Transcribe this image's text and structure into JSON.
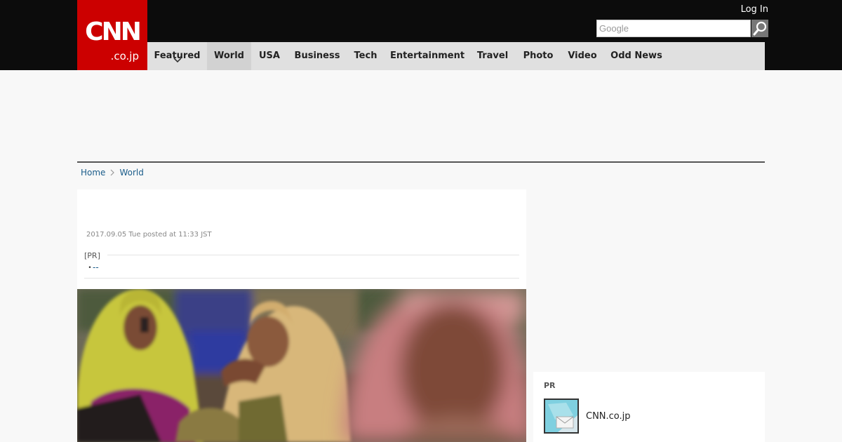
{
  "header": {
    "logo_main": "CNN",
    "logo_sub": ".co.jp",
    "login_label": "Log In",
    "search": {
      "placeholder": "Google",
      "button_icon": "magnifier-icon"
    }
  },
  "nav": {
    "items": [
      {
        "label": "Featured"
      },
      {
        "label": "World"
      },
      {
        "label": "USA"
      },
      {
        "label": "Business"
      },
      {
        "label": "Tech"
      },
      {
        "label": "Entertainment"
      },
      {
        "label": "Travel"
      },
      {
        "label": "Photo"
      },
      {
        "label": "Video"
      },
      {
        "label": "Odd News"
      }
    ],
    "active": "World",
    "featured_icon": "chevron-down-icon"
  },
  "breadcrumb": {
    "home": "Home",
    "current": "World",
    "separator_icon": "chevron-right-icon"
  },
  "article": {
    "posted": "2017.09.05 Tue posted at 11:33 JST",
    "pr_label": "[PR]",
    "pr_bullet": "・",
    "pr_link": "--"
  },
  "sidebar": {
    "pr_title": "PR",
    "pr_item_label": "CNN.co.jp",
    "pr_item_icon": "mail-icon"
  },
  "colors": {
    "brand_red": "#cc0000",
    "header_bg": "#0c0c0c",
    "nav_bg": "#e0e0e0",
    "link_blue": "#1a5c8a",
    "page_bg": "#f8f8f8"
  }
}
